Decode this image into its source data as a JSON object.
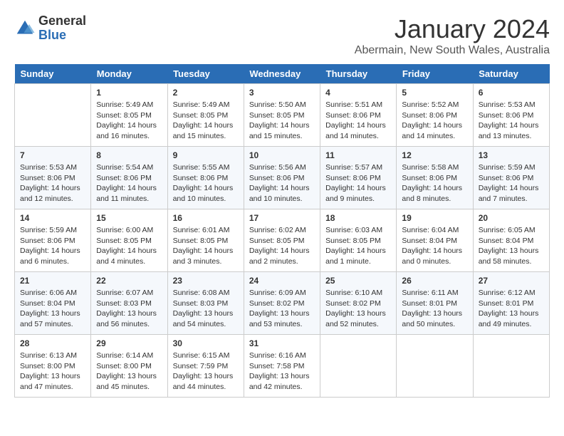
{
  "header": {
    "logo_general": "General",
    "logo_blue": "Blue",
    "month_title": "January 2024",
    "location": "Abermain, New South Wales, Australia"
  },
  "days_of_week": [
    "Sunday",
    "Monday",
    "Tuesday",
    "Wednesday",
    "Thursday",
    "Friday",
    "Saturday"
  ],
  "weeks": [
    [
      {
        "day": "",
        "info": ""
      },
      {
        "day": "1",
        "info": "Sunrise: 5:49 AM\nSunset: 8:05 PM\nDaylight: 14 hours\nand 16 minutes."
      },
      {
        "day": "2",
        "info": "Sunrise: 5:49 AM\nSunset: 8:05 PM\nDaylight: 14 hours\nand 15 minutes."
      },
      {
        "day": "3",
        "info": "Sunrise: 5:50 AM\nSunset: 8:05 PM\nDaylight: 14 hours\nand 15 minutes."
      },
      {
        "day": "4",
        "info": "Sunrise: 5:51 AM\nSunset: 8:06 PM\nDaylight: 14 hours\nand 14 minutes."
      },
      {
        "day": "5",
        "info": "Sunrise: 5:52 AM\nSunset: 8:06 PM\nDaylight: 14 hours\nand 14 minutes."
      },
      {
        "day": "6",
        "info": "Sunrise: 5:53 AM\nSunset: 8:06 PM\nDaylight: 14 hours\nand 13 minutes."
      }
    ],
    [
      {
        "day": "7",
        "info": "Sunrise: 5:53 AM\nSunset: 8:06 PM\nDaylight: 14 hours\nand 12 minutes."
      },
      {
        "day": "8",
        "info": "Sunrise: 5:54 AM\nSunset: 8:06 PM\nDaylight: 14 hours\nand 11 minutes."
      },
      {
        "day": "9",
        "info": "Sunrise: 5:55 AM\nSunset: 8:06 PM\nDaylight: 14 hours\nand 10 minutes."
      },
      {
        "day": "10",
        "info": "Sunrise: 5:56 AM\nSunset: 8:06 PM\nDaylight: 14 hours\nand 10 minutes."
      },
      {
        "day": "11",
        "info": "Sunrise: 5:57 AM\nSunset: 8:06 PM\nDaylight: 14 hours\nand 9 minutes."
      },
      {
        "day": "12",
        "info": "Sunrise: 5:58 AM\nSunset: 8:06 PM\nDaylight: 14 hours\nand 8 minutes."
      },
      {
        "day": "13",
        "info": "Sunrise: 5:59 AM\nSunset: 8:06 PM\nDaylight: 14 hours\nand 7 minutes."
      }
    ],
    [
      {
        "day": "14",
        "info": "Sunrise: 5:59 AM\nSunset: 8:06 PM\nDaylight: 14 hours\nand 6 minutes."
      },
      {
        "day": "15",
        "info": "Sunrise: 6:00 AM\nSunset: 8:05 PM\nDaylight: 14 hours\nand 4 minutes."
      },
      {
        "day": "16",
        "info": "Sunrise: 6:01 AM\nSunset: 8:05 PM\nDaylight: 14 hours\nand 3 minutes."
      },
      {
        "day": "17",
        "info": "Sunrise: 6:02 AM\nSunset: 8:05 PM\nDaylight: 14 hours\nand 2 minutes."
      },
      {
        "day": "18",
        "info": "Sunrise: 6:03 AM\nSunset: 8:05 PM\nDaylight: 14 hours\nand 1 minute."
      },
      {
        "day": "19",
        "info": "Sunrise: 6:04 AM\nSunset: 8:04 PM\nDaylight: 14 hours\nand 0 minutes."
      },
      {
        "day": "20",
        "info": "Sunrise: 6:05 AM\nSunset: 8:04 PM\nDaylight: 13 hours\nand 58 minutes."
      }
    ],
    [
      {
        "day": "21",
        "info": "Sunrise: 6:06 AM\nSunset: 8:04 PM\nDaylight: 13 hours\nand 57 minutes."
      },
      {
        "day": "22",
        "info": "Sunrise: 6:07 AM\nSunset: 8:03 PM\nDaylight: 13 hours\nand 56 minutes."
      },
      {
        "day": "23",
        "info": "Sunrise: 6:08 AM\nSunset: 8:03 PM\nDaylight: 13 hours\nand 54 minutes."
      },
      {
        "day": "24",
        "info": "Sunrise: 6:09 AM\nSunset: 8:02 PM\nDaylight: 13 hours\nand 53 minutes."
      },
      {
        "day": "25",
        "info": "Sunrise: 6:10 AM\nSunset: 8:02 PM\nDaylight: 13 hours\nand 52 minutes."
      },
      {
        "day": "26",
        "info": "Sunrise: 6:11 AM\nSunset: 8:01 PM\nDaylight: 13 hours\nand 50 minutes."
      },
      {
        "day": "27",
        "info": "Sunrise: 6:12 AM\nSunset: 8:01 PM\nDaylight: 13 hours\nand 49 minutes."
      }
    ],
    [
      {
        "day": "28",
        "info": "Sunrise: 6:13 AM\nSunset: 8:00 PM\nDaylight: 13 hours\nand 47 minutes."
      },
      {
        "day": "29",
        "info": "Sunrise: 6:14 AM\nSunset: 8:00 PM\nDaylight: 13 hours\nand 45 minutes."
      },
      {
        "day": "30",
        "info": "Sunrise: 6:15 AM\nSunset: 7:59 PM\nDaylight: 13 hours\nand 44 minutes."
      },
      {
        "day": "31",
        "info": "Sunrise: 6:16 AM\nSunset: 7:58 PM\nDaylight: 13 hours\nand 42 minutes."
      },
      {
        "day": "",
        "info": ""
      },
      {
        "day": "",
        "info": ""
      },
      {
        "day": "",
        "info": ""
      }
    ]
  ]
}
